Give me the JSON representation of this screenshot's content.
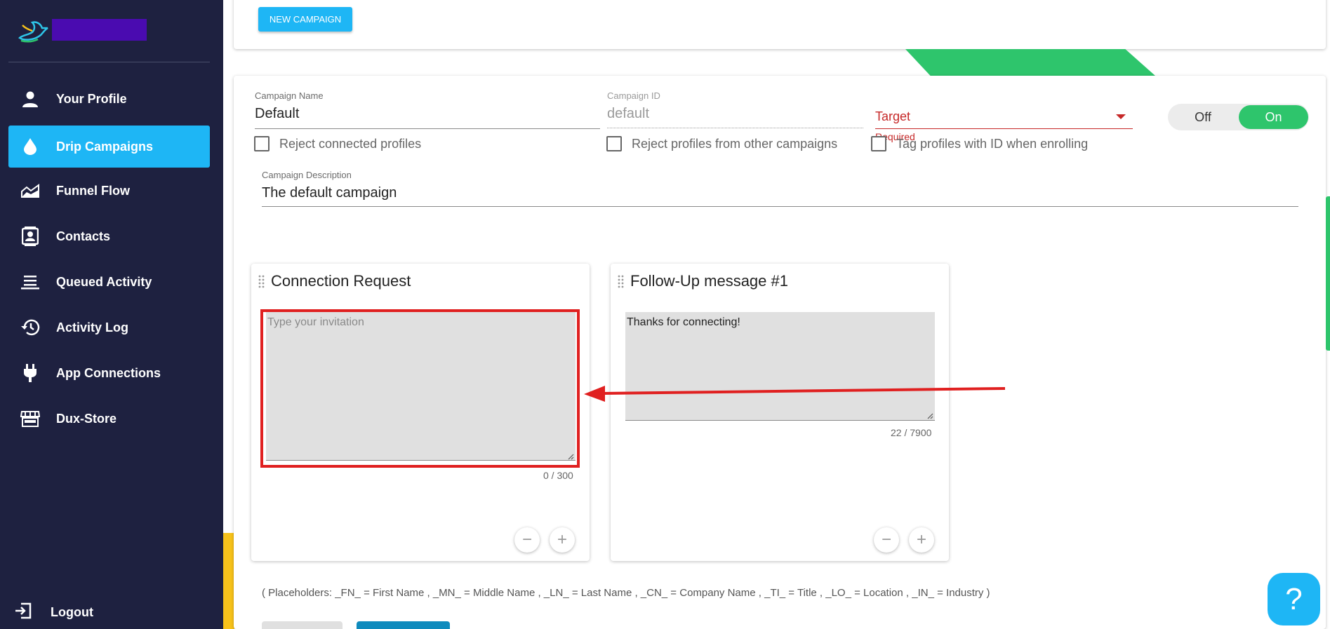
{
  "sidebar": {
    "items": [
      {
        "label": "Your Profile",
        "icon": "person-icon"
      },
      {
        "label": "Drip Campaigns",
        "icon": "drop-icon"
      },
      {
        "label": "Funnel Flow",
        "icon": "area-chart-icon"
      },
      {
        "label": "Contacts",
        "icon": "contact-card-icon"
      },
      {
        "label": "Queued Activity",
        "icon": "queue-list-icon"
      },
      {
        "label": "Activity Log",
        "icon": "history-icon"
      },
      {
        "label": "App Connections",
        "icon": "plug-icon"
      },
      {
        "label": "Dux-Store",
        "icon": "store-icon"
      }
    ],
    "active_index": 1,
    "logout_label": "Logout"
  },
  "toolbar": {
    "new_campaign_label": "NEW CAMPAIGN"
  },
  "campaign": {
    "name_label": "Campaign Name",
    "name_value": "Default",
    "id_label": "Campaign ID",
    "id_value": "default",
    "target_label": "Target",
    "target_required": "Required",
    "toggle_off": "Off",
    "toggle_on": "On",
    "toggle_state": "On",
    "reject_connected": "Reject connected profiles",
    "reject_other": "Reject profiles from other campaigns",
    "tag_profiles": "Tag profiles with ID when enrolling",
    "description_label": "Campaign Description",
    "description_value": "The default campaign"
  },
  "messages": [
    {
      "title": "Connection Request",
      "placeholder": "Type your invitation",
      "value": "",
      "count": "0 / 300"
    },
    {
      "title": "Follow-Up message #1",
      "placeholder": "",
      "value": "Thanks for connecting!",
      "count": "22 / 7900"
    }
  ],
  "placeholders_text": "( Placeholders: _FN_ = First Name , _MN_ = Middle Name , _LN_ = Last Name , _CN_ = Company Name , _TI_ = Title , _LO_ = Location , _IN_ = Industry )",
  "help_label": "?",
  "colors": {
    "sidebar_bg": "#1e2140",
    "accent": "#1eb6f5",
    "toggle_on": "#2ec56c",
    "error": "#c62828",
    "annotation": "#e02020"
  }
}
